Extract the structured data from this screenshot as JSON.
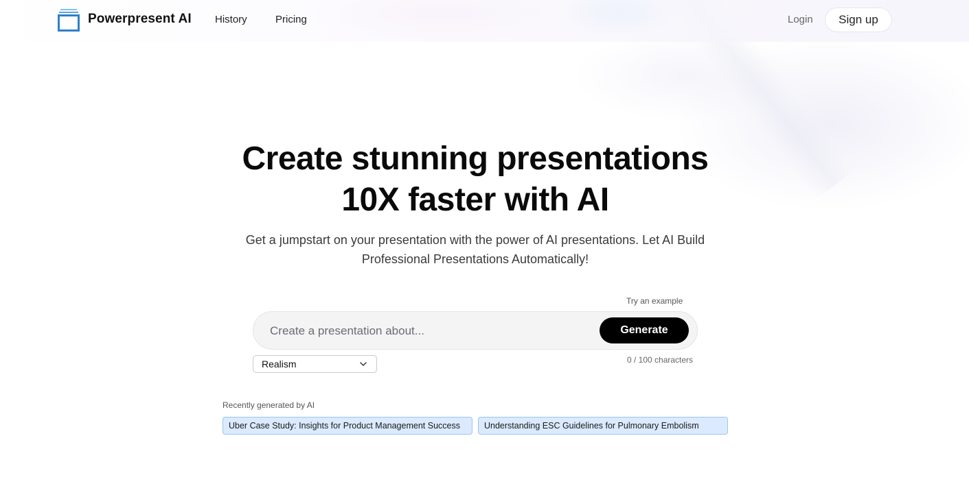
{
  "header": {
    "brand": "Powerpresent AI",
    "nav": [
      {
        "label": "History"
      },
      {
        "label": "Pricing"
      }
    ],
    "login_label": "Login",
    "signup_label": "Sign up"
  },
  "hero": {
    "title_line1": "Create stunning presentations",
    "title_line2": "10X faster with AI",
    "subtitle": "Get a jumpstart on your presentation with the power of AI presentations. Let AI Build Professional Presentations Automatically!"
  },
  "prompt": {
    "try_example_label": "Try an example",
    "placeholder": "Create a presentation about...",
    "value": "",
    "generate_label": "Generate",
    "char_count": "0 / 100 characters"
  },
  "style_select": {
    "selected": "Realism"
  },
  "recent": {
    "label": "Recently generated by AI",
    "items": [
      {
        "label": "Uber Case Study: Insights for Product Management Success"
      },
      {
        "label": "Understanding ESC Guidelines for Pulmonary Embolism"
      }
    ]
  },
  "icons": {
    "logo": "stacked-window-logo-icon",
    "select": "chevron-down-icon"
  },
  "colors": {
    "generate_bg": "#000000",
    "chip_bg": "#dbeafe",
    "chip_border": "#9ec5f0",
    "logo_blue": "#2f80c8",
    "logo_light": "#7fc3e3"
  }
}
